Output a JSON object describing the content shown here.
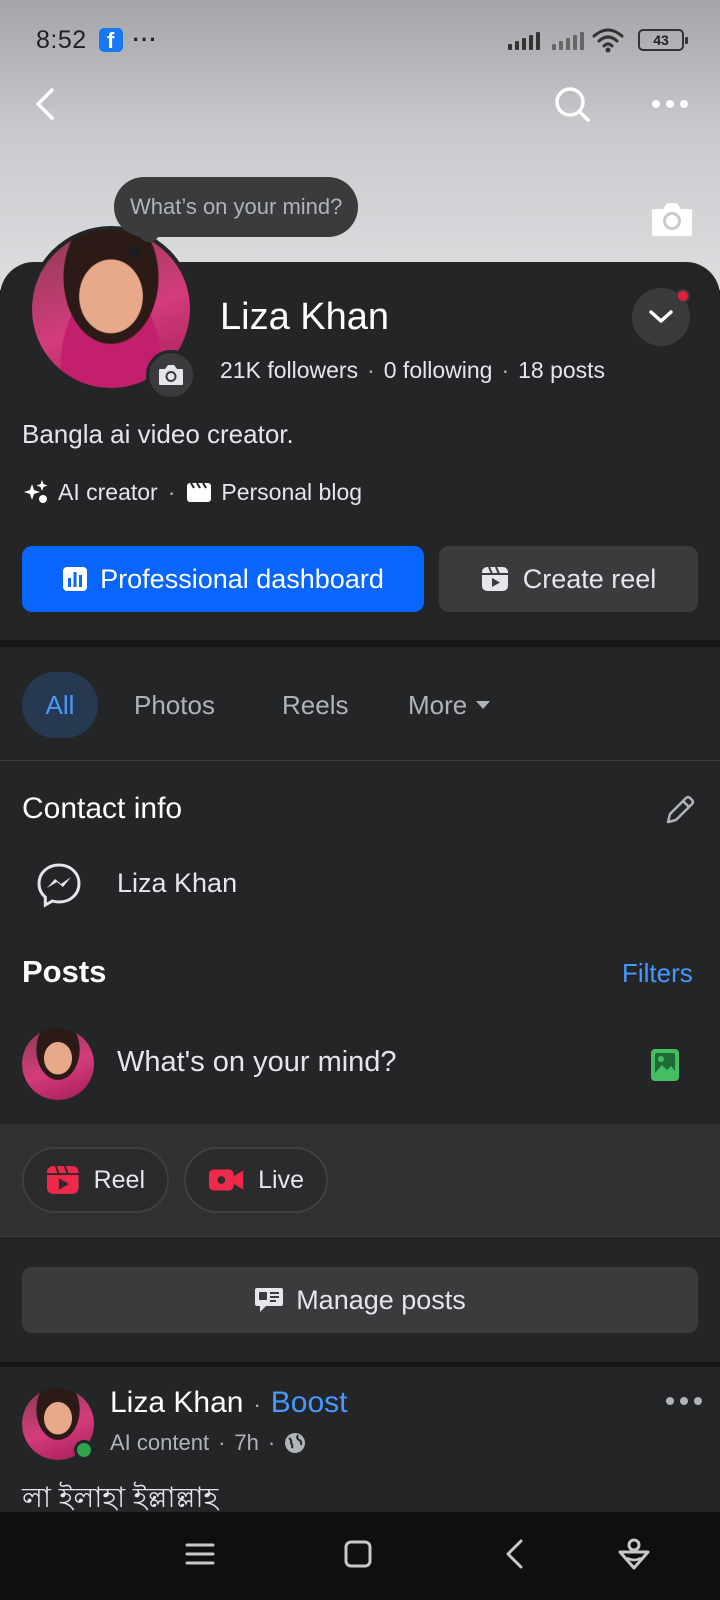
{
  "status_bar": {
    "time": "8:52",
    "app_icon": "facebook-icon",
    "notification_more": "···",
    "battery_level": "43"
  },
  "cover": {
    "mind_bubble_text": "What’s on your mind?"
  },
  "profile": {
    "name": "Liza Khan",
    "followers": "21K followers",
    "following": "0 following",
    "posts_count": "18 posts",
    "separator": "·",
    "bio": "Bangla ai video creator.",
    "tags": [
      {
        "label": "AI creator",
        "icon": "sparkle-icon"
      },
      {
        "label": "Personal blog",
        "icon": "clapper-icon"
      }
    ],
    "has_notification_dot": true
  },
  "buttons": {
    "dashboard_label": "Professional dashboard",
    "create_reel_label": "Create reel"
  },
  "tabs": [
    {
      "label": "All",
      "active": true
    },
    {
      "label": "Photos",
      "active": false
    },
    {
      "label": "Reels",
      "active": false
    },
    {
      "label": "More",
      "active": false
    }
  ],
  "contact": {
    "title": "Contact info",
    "messenger_name": "Liza Khan"
  },
  "posts": {
    "title": "Posts",
    "filters_label": "Filters",
    "composer_placeholder": "What's on your mind?",
    "reel_label": "Reel",
    "live_label": "Live",
    "manage_label": "Manage posts"
  },
  "post": {
    "author": "Liza Khan",
    "separator": "·",
    "boost_label": "Boost",
    "content_type": "AI content",
    "time_ago": "7h",
    "privacy_icon": "globe-icon",
    "text": "লা ইলাহা ইল্লাল্লাহ"
  },
  "colors": {
    "background": "#242527",
    "primary_blue": "#0866ff",
    "link_blue": "#4599ff",
    "online_green": "#31a24c",
    "reel_red": "#f0284a"
  }
}
